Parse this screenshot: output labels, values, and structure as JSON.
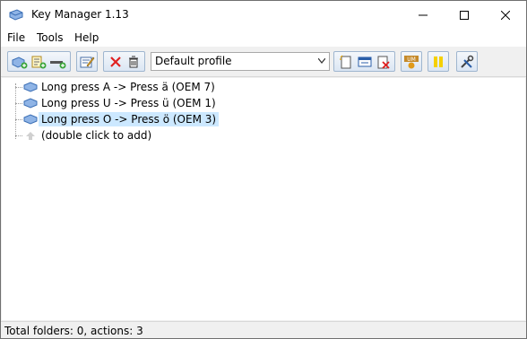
{
  "window": {
    "title": "Key Manager 1.13"
  },
  "menu": {
    "items": [
      "File",
      "Tools",
      "Help"
    ]
  },
  "toolbar": {
    "profile": {
      "selected": "Default profile"
    },
    "buttons": [
      "add-action",
      "add-folder",
      "add-separator",
      "edit",
      "delete",
      "recycle",
      "new-profile",
      "window-profile",
      "delete-profile",
      "user-mode",
      "pause",
      "settings"
    ]
  },
  "tree": {
    "items": [
      {
        "label": "Long press A -> Press ä (OEM 7)"
      },
      {
        "label": "Long press U -> Press ü (OEM 1)"
      },
      {
        "label": "Long press O -> Press ö (OEM 3)",
        "selected": true
      },
      {
        "label": "(double click to add)"
      }
    ]
  },
  "status": {
    "text": "Total folders: 0, actions: 3"
  },
  "colors": {
    "selection": "#cce8ff",
    "accent": "#3b7dd8",
    "delete": "#e02020",
    "pause": "#f5d000"
  }
}
